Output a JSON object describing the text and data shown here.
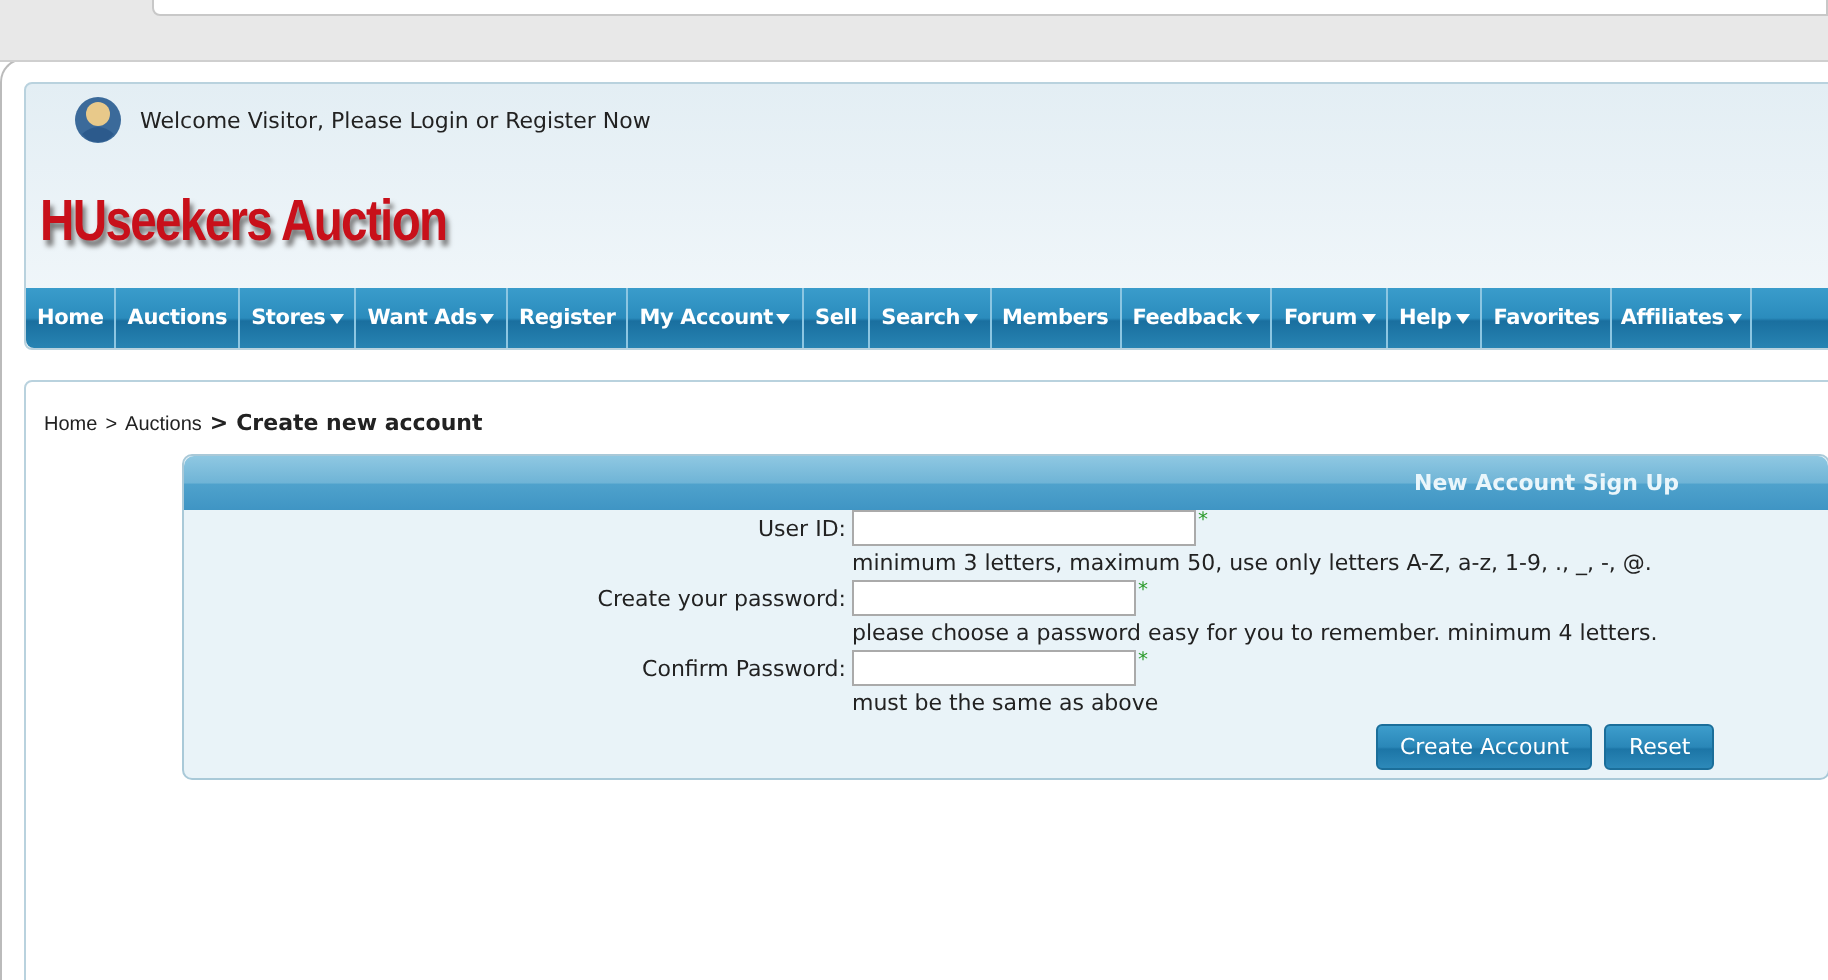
{
  "header": {
    "welcome": "Welcome Visitor, Please Login or Register Now",
    "logo": "HUseekers Auction"
  },
  "nav": [
    {
      "label": "Home",
      "dropdown": false
    },
    {
      "label": "Auctions",
      "dropdown": false
    },
    {
      "label": "Stores",
      "dropdown": true
    },
    {
      "label": "Want Ads",
      "dropdown": true
    },
    {
      "label": "Register",
      "dropdown": false
    },
    {
      "label": "My Account",
      "dropdown": true
    },
    {
      "label": "Sell",
      "dropdown": false
    },
    {
      "label": "Search",
      "dropdown": true
    },
    {
      "label": "Members",
      "dropdown": false
    },
    {
      "label": "Feedback",
      "dropdown": true
    },
    {
      "label": "Forum",
      "dropdown": true
    },
    {
      "label": "Help",
      "dropdown": true
    },
    {
      "label": "Favorites",
      "dropdown": false
    },
    {
      "label": "Affiliates",
      "dropdown": true
    }
  ],
  "breadcrumb": {
    "links": [
      "Home",
      "Auctions"
    ],
    "separator": ">",
    "current_separator": ">",
    "current": "Create new account"
  },
  "form": {
    "title": "New Account Sign Up",
    "fields": [
      {
        "label": "User ID:",
        "hint": "minimum 3 letters, maximum 50, use only letters A-Z, a-z, 1-9, ., _, -, @.",
        "required_mark": "*"
      },
      {
        "label": "Create your password:",
        "hint": "please choose a password easy for you to remember. minimum 4 letters.",
        "required_mark": "*"
      },
      {
        "label": "Confirm Password:",
        "hint": "must be the same as above",
        "required_mark": "*"
      }
    ],
    "buttons": [
      "Create Account",
      "Reset"
    ]
  }
}
